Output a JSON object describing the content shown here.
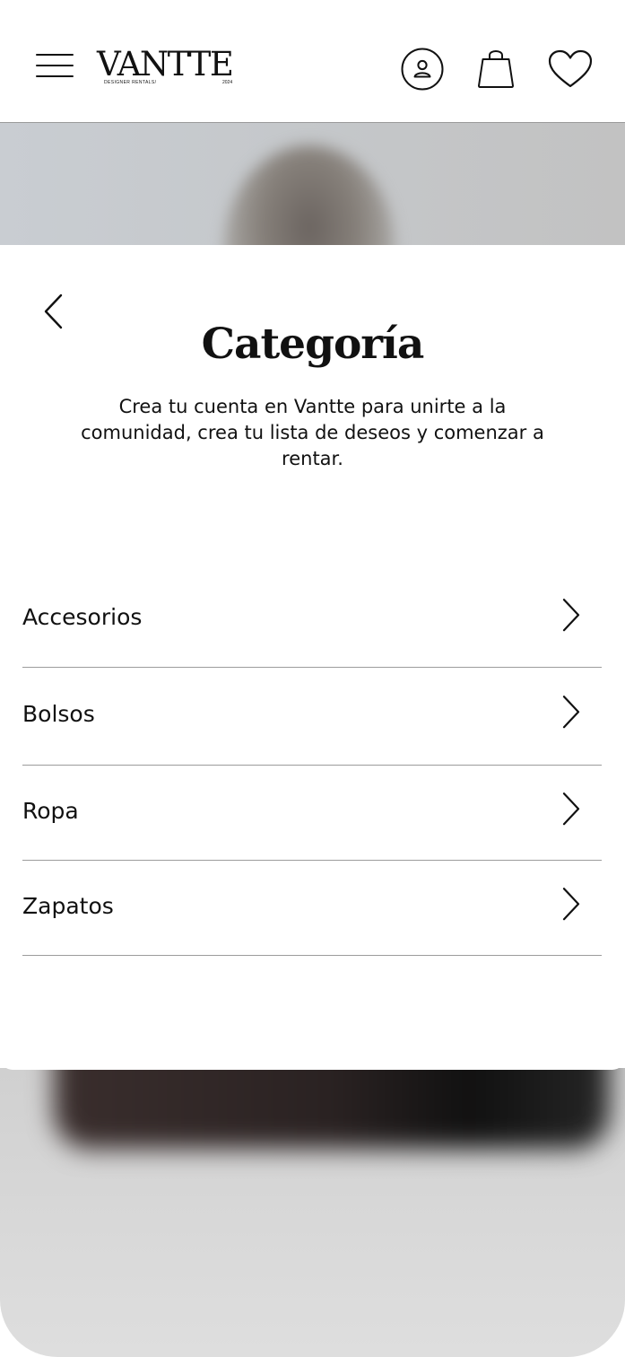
{
  "header": {
    "brand": {
      "name": "VANTTE",
      "tagline": "DESIGNER RENTALS/",
      "year": "2024"
    },
    "icons": {
      "menu": "hamburger-menu-icon",
      "account": "user-account-icon",
      "bag": "shopping-bag-icon",
      "wishlist": "heart-icon"
    }
  },
  "panel": {
    "title": "Categoría",
    "description": "Crea tu cuenta en Vantte para unirte a la comunidad, crea tu lista de deseos y comenzar a rentar.",
    "categories": [
      {
        "label": "Accesorios"
      },
      {
        "label": "Bolsos"
      },
      {
        "label": "Ropa"
      },
      {
        "label": "Zapatos"
      }
    ]
  },
  "colors": {
    "text": "#111111",
    "divider": "#9c9c9c",
    "background": "#ffffff"
  }
}
